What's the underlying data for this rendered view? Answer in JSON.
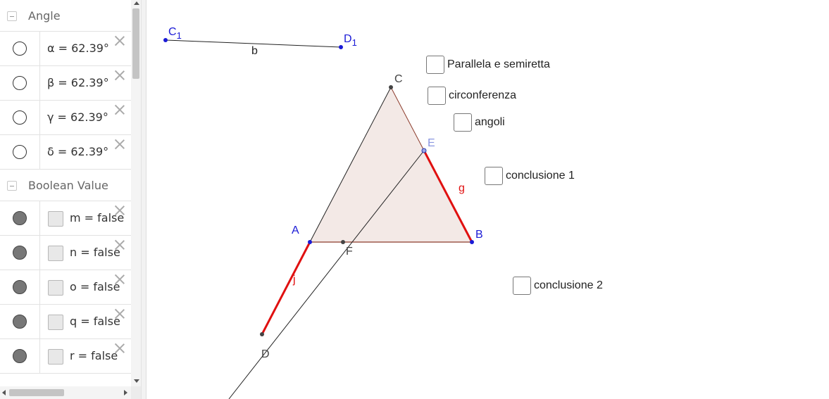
{
  "algebra": {
    "angle_group": {
      "title": "Angle",
      "rows": [
        {
          "text": "α = 62.39°"
        },
        {
          "text": "β = 62.39°"
        },
        {
          "text": "γ = 62.39°"
        },
        {
          "text": "δ = 62.39°"
        }
      ]
    },
    "boolean_group": {
      "title": "Boolean Value",
      "rows": [
        {
          "text": "m = false"
        },
        {
          "text": "n = false"
        },
        {
          "text": "o = false"
        },
        {
          "text": "q = false"
        },
        {
          "text": "r = false"
        }
      ]
    }
  },
  "graphics": {
    "points": {
      "C1": {
        "name": "C",
        "sub": "1"
      },
      "D1": {
        "name": "D",
        "sub": "1"
      },
      "C": "C",
      "E": "E",
      "A": "A",
      "B": "B",
      "F": "F",
      "D": "D"
    },
    "segment_labels": {
      "b": "b",
      "g": "g",
      "j": "j"
    },
    "checkboxes": [
      {
        "label": "Parallela e semiretta"
      },
      {
        "label": "circonferenza"
      },
      {
        "label": "angoli"
      },
      {
        "label": "conclusione 1"
      },
      {
        "label": "conclusione 2"
      }
    ]
  },
  "colors": {
    "point_blue": "#1a1ad6",
    "segment_red": "#e01010",
    "triangle_fill": "#f3e9e6",
    "triangle_edge": "#8b3a2a"
  }
}
